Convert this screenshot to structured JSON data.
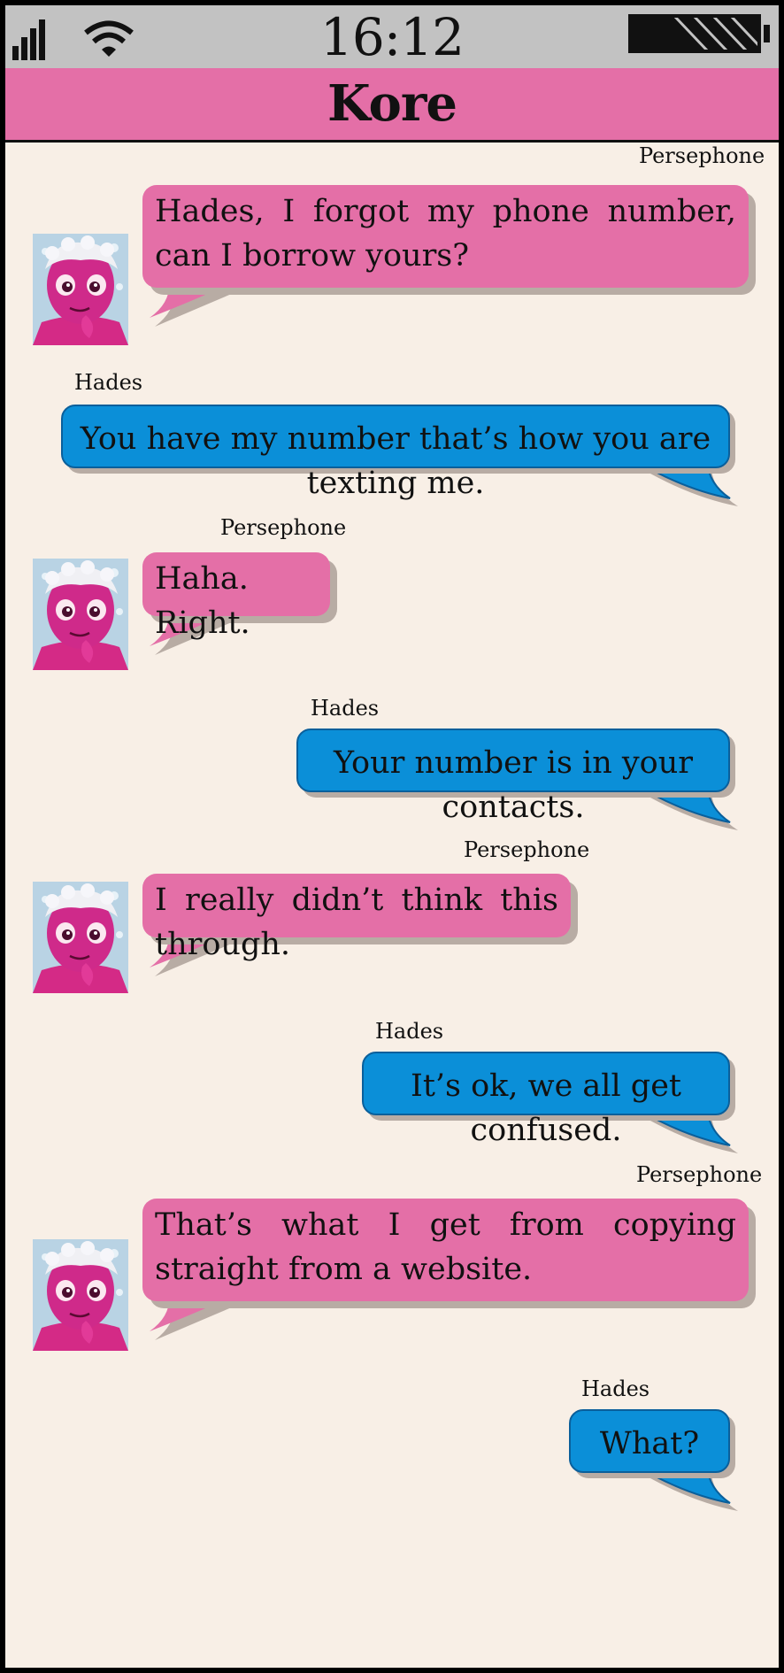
{
  "status_bar": {
    "time": "16:12",
    "icons": [
      "signal-icon",
      "wifi-icon",
      "battery-icon"
    ]
  },
  "chat": {
    "title": "Kore"
  },
  "colors": {
    "persephone_bubble": "#e46fa7",
    "hades_bubble": "#0b8fd8",
    "background": "#f8efe6",
    "status_bar": "#c2c2c2"
  },
  "messages": [
    {
      "sender": "Persephone",
      "text": "Hades, I forgot my phone number, can I borrow yours?"
    },
    {
      "sender": "Hades",
      "text": "You have my number that’s how you are texting me."
    },
    {
      "sender": "Persephone",
      "text": "Haha.  Right."
    },
    {
      "sender": "Hades",
      "text": "Your number is in your contacts."
    },
    {
      "sender": "Persephone",
      "text": "I really didn’t think this through."
    },
    {
      "sender": "Hades",
      "text": "It’s ok, we all get confused."
    },
    {
      "sender": "Persephone",
      "text": "That’s what I get from copying straight from a website."
    },
    {
      "sender": "Hades",
      "text": "What?"
    }
  ]
}
